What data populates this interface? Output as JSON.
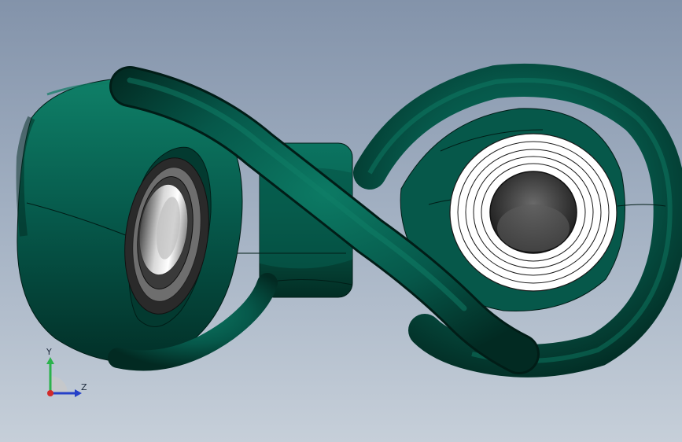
{
  "viewport": {
    "background_top": "#8393aa",
    "background_bottom": "#c6cfd9"
  },
  "model": {
    "body_color": "#06584a",
    "body_shadow": "#02261f",
    "bearing_color": "#ffffff",
    "bore_color": "#3a3a3a"
  },
  "triad": {
    "y_label": "Y",
    "z_label": "Z",
    "y_color": "#2bb24c",
    "z_color": "#2540c8",
    "x_color": "#d22a2a"
  }
}
